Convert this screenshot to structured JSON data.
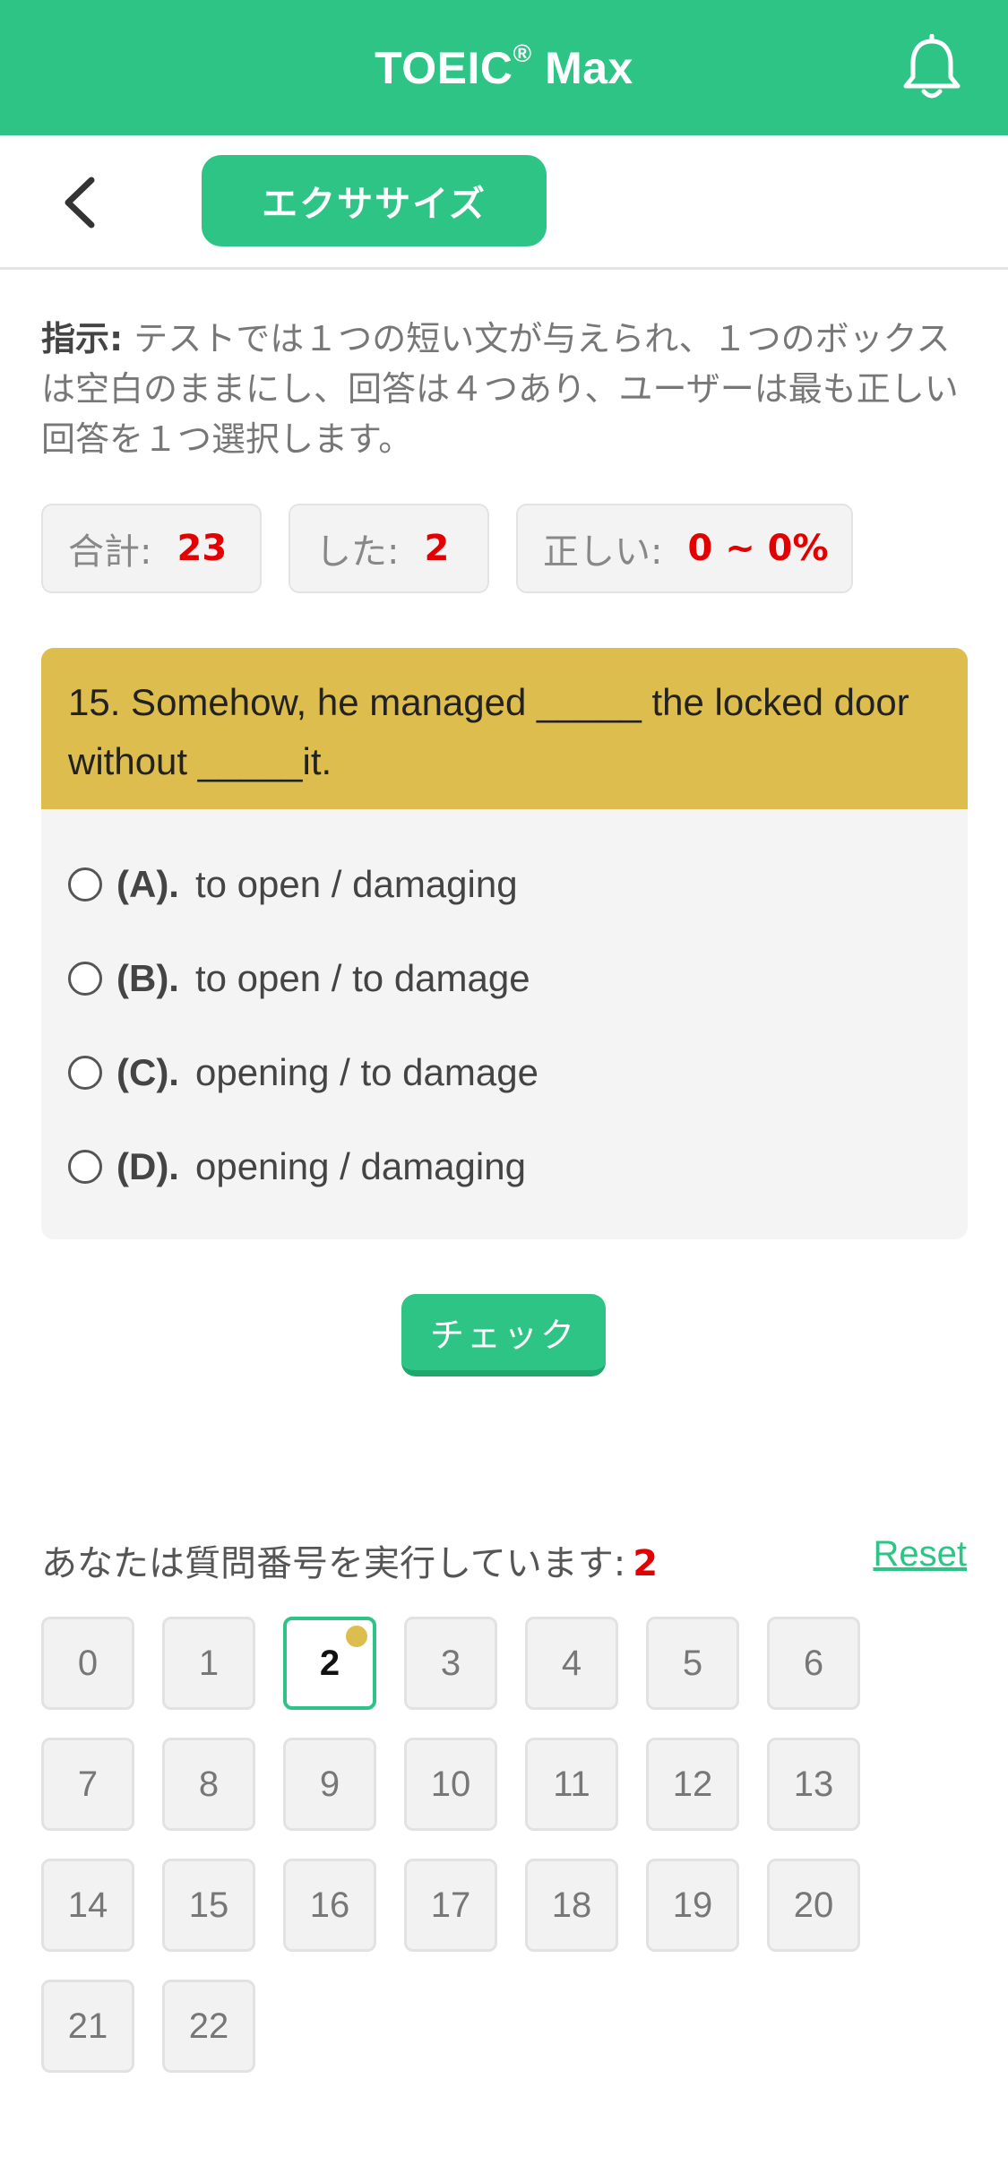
{
  "header": {
    "title": "TOEIC",
    "title_sup": "®",
    "title_suffix": " Max"
  },
  "nav": {
    "exercise_tab": "エクササイズ"
  },
  "instructions": {
    "label": "指示:",
    "text": " テストでは１つの短い文が与えられ、１つのボックスは空白のままにし、回答は４つあり、ユーザーは最も正しい回答を１つ選択します。"
  },
  "stats": {
    "total_label": "合計:",
    "total_value": "23",
    "done_label": "した:",
    "done_value": "2",
    "correct_label": "正しい:",
    "correct_value": "0 ~ 0%"
  },
  "question": {
    "text": "15. Somehow, he managed _____ the locked door without _____it.",
    "options": [
      {
        "label": "(A).",
        "text": "to open / damaging"
      },
      {
        "label": "(B).",
        "text": "to open / to damage"
      },
      {
        "label": "(C).",
        "text": "opening / to damage"
      },
      {
        "label": "(D).",
        "text": "opening / damaging"
      }
    ]
  },
  "check_button": "チェック",
  "progress": {
    "running_label": "あなたは質問番号を実行しています:",
    "current": "2",
    "reset_label": "Reset"
  },
  "numbers": [
    "0",
    "1",
    "2",
    "3",
    "4",
    "5",
    "6",
    "7",
    "8",
    "9",
    "10",
    "11",
    "12",
    "13",
    "14",
    "15",
    "16",
    "17",
    "18",
    "19",
    "20",
    "21",
    "22"
  ],
  "colors": {
    "accent": "#2ec486",
    "question_bg": "#dcbd4e",
    "highlight": "#e30000"
  }
}
